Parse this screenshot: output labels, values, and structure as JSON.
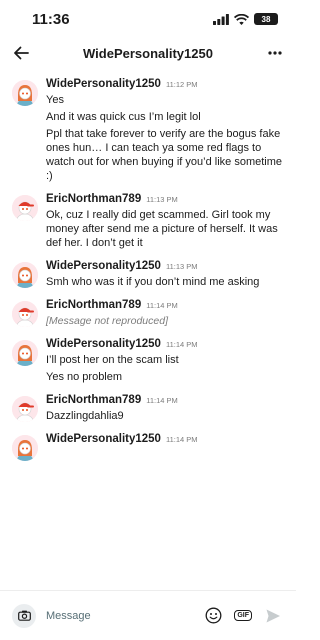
{
  "status_bar": {
    "time": "11:36",
    "battery": "38"
  },
  "header": {
    "title": "WidePersonality1250"
  },
  "messages": [
    {
      "user": "WidePersonality1250",
      "time": "11:12 PM",
      "avatar": "orange-hair",
      "lines": [
        "Yes",
        "And it was quick cus I’m legit lol",
        "Ppl that take forever to verify are the bogus fake ones hun… I can teach ya some red flags to watch out for when buying if you’d like sometime :)"
      ]
    },
    {
      "user": "EricNorthman789",
      "time": "11:13 PM",
      "avatar": "cap",
      "lines": [
        "Ok, cuz I really did get scammed. Girl took my money after send me a picture of herself. It was def her.  I don’t get it"
      ]
    },
    {
      "user": "WidePersonality1250",
      "time": "11:13 PM",
      "avatar": "orange-hair",
      "lines": [
        "Smh who was it if you don’t mind me asking"
      ]
    },
    {
      "user": "EricNorthman789",
      "time": "11:14 PM",
      "avatar": "cap",
      "lines": [],
      "omitted_note": "[Message not reproduced]"
    },
    {
      "user": "WidePersonality1250",
      "time": "11:14 PM",
      "avatar": "orange-hair",
      "lines": [
        "I’ll post her on the scam list",
        "Yes no problem"
      ]
    },
    {
      "user": "EricNorthman789",
      "time": "11:14 PM",
      "avatar": "cap",
      "lines": [
        "Dazzlingdahlia9"
      ]
    },
    {
      "user": "WidePersonality1250",
      "time": "11:14 PM",
      "avatar": "orange-hair",
      "lines": []
    }
  ],
  "composer": {
    "placeholder": "Message",
    "gif_label": "GIF"
  }
}
